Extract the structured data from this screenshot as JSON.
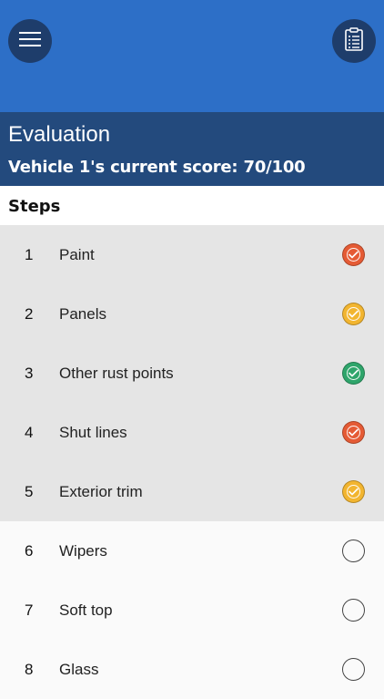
{
  "topbar": {
    "menu_icon": "hamburger-menu-icon",
    "clipboard_icon": "clipboard-list-icon",
    "color": "#2d6fc7"
  },
  "header": {
    "title": "Evaluation",
    "score_text": "Vehicle 1's current score: 70/100",
    "color": "#234a7d"
  },
  "steps": {
    "heading": "Steps",
    "items": [
      {
        "num": "1",
        "label": "Paint",
        "status": "red",
        "color": "#e55b35"
      },
      {
        "num": "2",
        "label": "Panels",
        "status": "yellow",
        "color": "#f2b530"
      },
      {
        "num": "3",
        "label": "Other rust points",
        "status": "green",
        "color": "#2fa56b"
      },
      {
        "num": "4",
        "label": "Shut lines",
        "status": "red",
        "color": "#e55b35"
      },
      {
        "num": "5",
        "label": "Exterior trim",
        "status": "yellow",
        "color": "#f2b530"
      },
      {
        "num": "6",
        "label": "Wipers",
        "status": "empty",
        "color": ""
      },
      {
        "num": "7",
        "label": "Soft top",
        "status": "empty",
        "color": ""
      },
      {
        "num": "8",
        "label": "Glass",
        "status": "empty",
        "color": ""
      }
    ]
  }
}
